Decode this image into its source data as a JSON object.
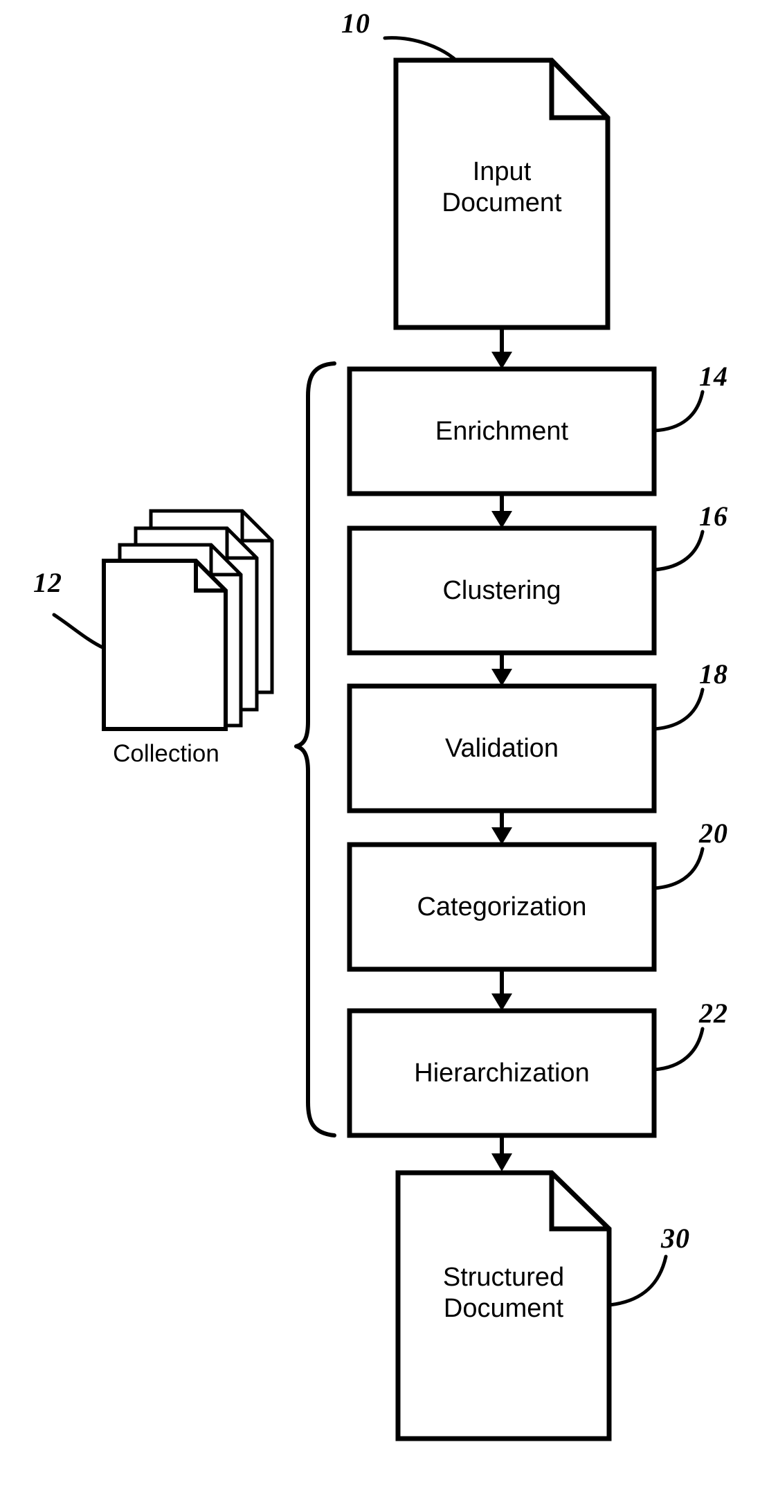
{
  "figure": {
    "type": "patent-flow-diagram",
    "background_color": "#ffffff",
    "line_color": "#000000"
  },
  "input_document": {
    "ref": "10",
    "label_line1": "Input",
    "label_line2": "Document",
    "shape": "document-with-folded-corner"
  },
  "collection": {
    "ref": "12",
    "label": "Collection",
    "shape": "stacked-documents",
    "sheet_count": 4
  },
  "process_steps": [
    {
      "ref": "14",
      "label": "Enrichment"
    },
    {
      "ref": "16",
      "label": "Clustering"
    },
    {
      "ref": "18",
      "label": "Validation"
    },
    {
      "ref": "20",
      "label": "Categorization"
    },
    {
      "ref": "22",
      "label": "Hierarchization"
    }
  ],
  "output_document": {
    "ref": "30",
    "label_line1": "Structured",
    "label_line2": "Document",
    "shape": "document-with-folded-corner"
  },
  "brace": {
    "orientation": "left-pointing",
    "spans_steps": [
      "14",
      "16",
      "18",
      "20",
      "22"
    ]
  }
}
